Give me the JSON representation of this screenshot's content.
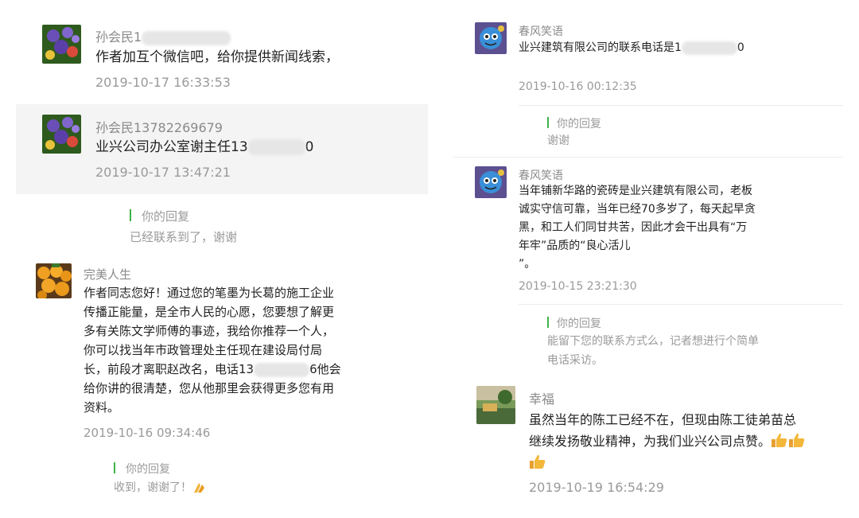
{
  "left": {
    "comments": [
      {
        "name_prefix": "孙会民1",
        "text": "作者加互个微信吧，给你提供新闻线索，",
        "time": "2019-10-17 16:33:53"
      },
      {
        "name": "孙会民13782269679",
        "text_prefix": "业兴公司办公室谢主任13",
        "text_suffix": "0",
        "time": "2019-10-17 13:47:21",
        "reply_label": "你的回复",
        "reply_text": "已经联系到了，谢谢"
      },
      {
        "name": "完美人生",
        "lines": [
          "作者同志您好！通过您的笔墨为长葛的施工企业",
          "传播正能量，是全市人民的心愿，您要想了解更",
          "多有关陈文学师傅的事迹，我给你推荐一个人，",
          "你可以找当年市政管理处主任现在建设局付局",
          "长，前段才离职赵改名，电话13",
          "6他会",
          "给你讲的很清楚，您从他那里会获得更多您有用",
          "资料。"
        ],
        "time": "2019-10-16 09:34:46",
        "reply_label": "你的回复",
        "reply_text": "收到，谢谢了！"
      }
    ]
  },
  "right": {
    "comments": [
      {
        "name": "春风笑语",
        "text_prefix": "业兴建筑有限公司的联系电话是1",
        "text_suffix": "0",
        "time": "2019-10-16 00:12:35",
        "reply_label": "你的回复",
        "reply_text": "谢谢"
      },
      {
        "name": "春风笑语",
        "lines": [
          "当年铺新华路的瓷砖是业兴建筑有限公司，老板",
          "诚实守信可靠，当年已经70多岁了，每天起早贪",
          "黑，和工人们同甘共苦，因此才会干出具有“万",
          "年牢”品质的“良心活儿",
          "”。"
        ],
        "time": "2019-10-15 23:21:30",
        "reply_label": "你的回复",
        "reply_lines": [
          "能留下您的联系方式么，记者想进行个简单",
          "电话采访。"
        ]
      },
      {
        "name": "幸福",
        "lines": [
          "虽然当年的陈工已经不在，但现由陈工徒弟苗总",
          "继续发扬敬业精神，为我们业兴公司点赞。"
        ],
        "time": "2019-10-19 16:54:29"
      }
    ]
  },
  "colors": {
    "reply_bar": "#3cb34a",
    "name_gray": "#8a8a8a",
    "time_gray": "#9a9a9a",
    "highlight_bg": "#f4f4f4"
  }
}
